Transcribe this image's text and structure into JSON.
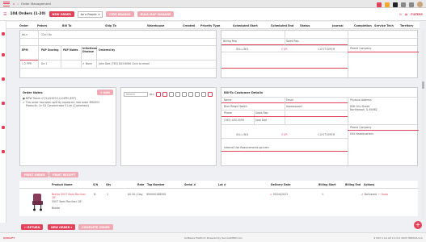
{
  "topbar": {
    "title": "Order Management"
  },
  "orderbar": {
    "title": "104 Orders (1-20)",
    "new_order": "NEW ORDER",
    "select_value": "be a People",
    "btn_assign": "ITEM BRANDS",
    "btn_map": "BULK MAP MANAGE",
    "filters": "FILTERS"
  },
  "table_headers": [
    "Order",
    "Pators",
    "Bill To",
    "Ship To",
    "Warehouse",
    "Created",
    "Priority Type",
    "Scheduled Start",
    "Scheduled End",
    "Status",
    "Journal",
    "Completion",
    "Service Tech",
    "Territory"
  ],
  "panel_top_left": {
    "rows": [
      {
        "a": "bb-n",
        "b": "12x1 8x"
      },
      {
        "a": "EPM",
        "b": "PAP Scoring",
        "c": "PAP Notes",
        "d": "Infectious Disease",
        "e": "Ordered by"
      },
      {
        "a": "1 2 PPR",
        "b": "Dx 1",
        "c": "",
        "d": "None",
        "e": "John Doe (763) 843-6060 Click to email"
      }
    ]
  },
  "panel_top_right": {
    "billing_rep": "Billing Rep",
    "sales_rep": "Sales Rep",
    "tabs": [
      "BILLING",
      "CSR",
      "CUSTOMER"
    ],
    "parent_company": "Parent Company"
  },
  "order_notes": {
    "title": "Order Notes",
    "add_btn": "+ ADD",
    "lines": [
      "● MPW Tracer 07/14/2023 12:24PM (EST)",
      "✔ This order has been split by mpwtcm1 into order MS0001",
      "Products: 1x O2 Concentrator 5 L/m (Customary)"
    ]
  },
  "middle": {
    "search_placeholder": "Search",
    "all": "ALL"
  },
  "customer_details": {
    "title": "Bill-To Customer Details",
    "name_label": "Name",
    "name_value": "Blue Ridge Health",
    "phone_label": "Phone",
    "phone_value": "(763) 450-3559",
    "email_label": "Email",
    "email_value": "mpwsupport",
    "sales_rep_label": "Sales Rep",
    "sales_rep_value": "Jane Doe",
    "physical_address_label": "Physical Address",
    "physical_address": [
      "836 City Street",
      "Northbrook, IL 60062"
    ],
    "parent_company": "Parent Company",
    "parent_company_value": "Gilk Headquarters",
    "internal_label": "Internal Use Requirements go here",
    "tabs": [
      "BILLING",
      "CSR",
      "CUSTOMER"
    ]
  },
  "action_buttons": {
    "print_order": "PRINT ORDER",
    "print_receipt": "PRINT RECEIPT"
  },
  "product_table": {
    "headers": [
      "Product Name",
      "S/N",
      "Qty",
      "Rate",
      "Tag Number",
      "Serial #",
      "Lot #",
      "Delivery Date",
      "Billing Start",
      "Billing End",
      "Actions"
    ],
    "row": {
      "name": "Bratta 30VT Semi Recliner 18\"",
      "sub1": "30VT Semi Recliner 18\"",
      "sub2": "Bratta",
      "sn": "N",
      "qty": "1",
      "rate": "$0.50 / Day",
      "tag": "900000168599",
      "delivery": "05/04/2023",
      "status": "Delivered",
      "undo": "Undo"
    }
  },
  "bottom_buttons": {
    "return": "RETURN",
    "new_order": "NEW ORDER",
    "complete": "COMPLETE ORDER"
  },
  "footer": {
    "brand": "QUALIFY",
    "center": "Software Platform Powered by ServiceMPW.com",
    "right": "9 DAY  2 LG AP  2.1.0.0  2023 HRPASS LLC"
  },
  "colors": {
    "accent": "#e2435a"
  }
}
